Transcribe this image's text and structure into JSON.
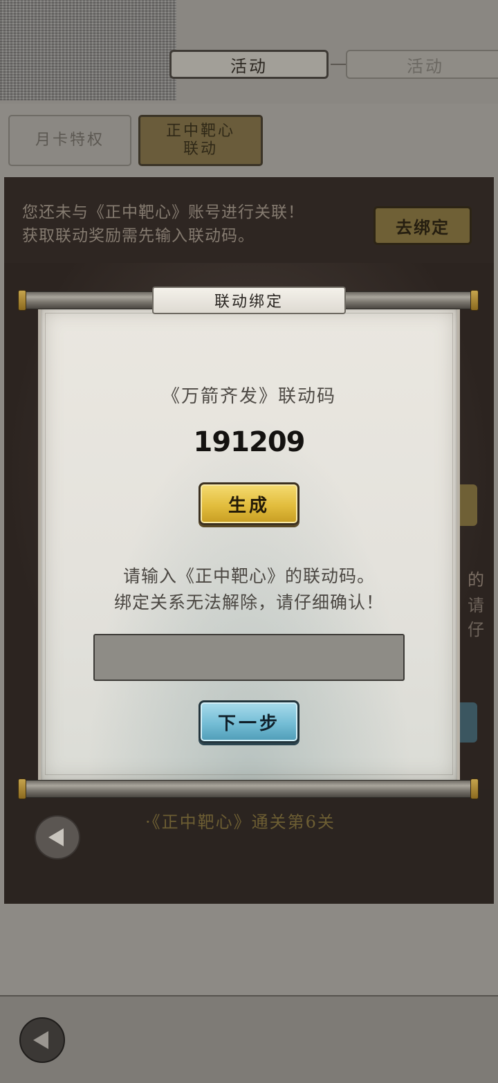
{
  "header": {
    "tab_active": "活动",
    "tab_inactive": "活动"
  },
  "sub_tabs": {
    "monthly": "月卡特权",
    "link_line1": "正中靶心",
    "link_line2": "联动"
  },
  "panel": {
    "notice_line1": "您还未与《正中靶心》账号进行关联！",
    "notice_line2": "获取联动奖励需先输入联动码。",
    "bind_button": "去绑定",
    "bottom_text": "·《正中靶心》通关第6关",
    "side_text_1": "的",
    "side_text_2": "请仔"
  },
  "modal": {
    "title": "联动绑定",
    "code_label": "《万箭齐发》联动码",
    "code_value": "191209",
    "generate_button": "生成",
    "instruction_line1": "请输入《正中靶心》的联动码。",
    "instruction_line2": "绑定关系无法解除，请仔细确认！",
    "input_value": "",
    "next_button": "下一步"
  },
  "colors": {
    "generate_button": "#e2bd3d",
    "next_button": "#74bdd5",
    "panel_bg": "#2e2622"
  }
}
